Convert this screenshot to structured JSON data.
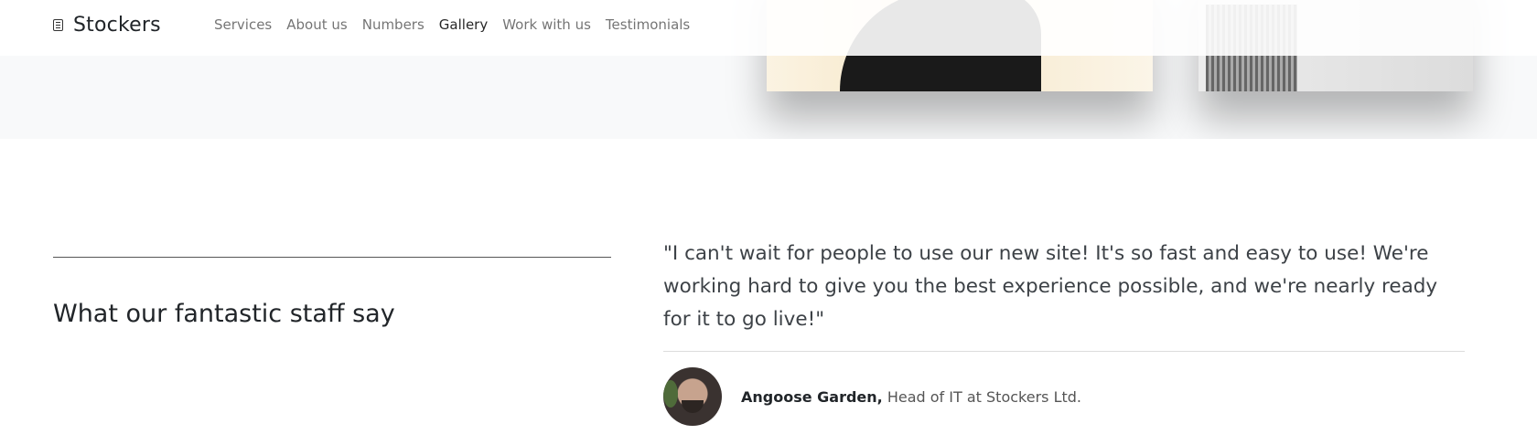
{
  "header": {
    "brand": "Stockers",
    "brand_icon": "document-icon",
    "nav": [
      {
        "label": "Services",
        "active": false
      },
      {
        "label": "About us",
        "active": false
      },
      {
        "label": "Numbers",
        "active": false
      },
      {
        "label": "Gallery",
        "active": true
      },
      {
        "label": "Work with us",
        "active": false
      },
      {
        "label": "Testimonials",
        "active": false
      }
    ]
  },
  "testimonials": {
    "title": "What our fantastic staff say",
    "quote": "\"I can't wait for people to use our new site! It's so fast and easy to use! We're working hard to give you the best experience possible, and we're nearly ready for it to go live!\"",
    "author_name": "Angoose Garden,",
    "author_role": "Head of IT at Stockers Ltd."
  },
  "colors": {
    "band_background": "#f8f9fa",
    "text": "#212529",
    "muted_text": "#3d4247"
  }
}
